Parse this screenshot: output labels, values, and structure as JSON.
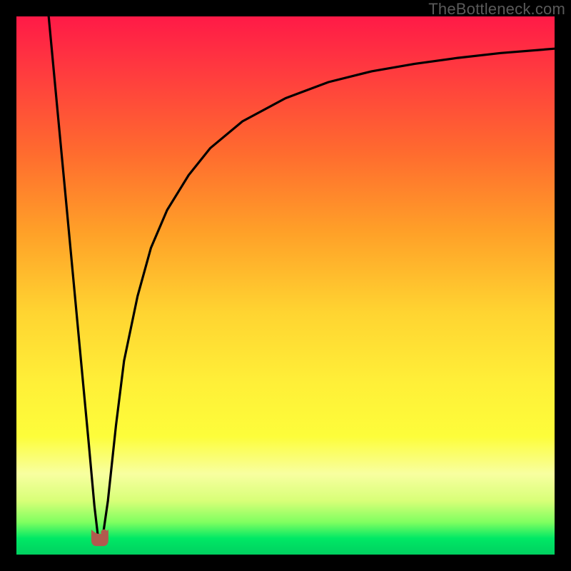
{
  "watermark": "TheBottleneck.com",
  "chart_data": {
    "type": "line",
    "title": "",
    "xlabel": "",
    "ylabel": "",
    "xlim": [
      0,
      100
    ],
    "ylim": [
      0,
      100
    ],
    "grid": false,
    "notes": "No numeric axes, tick labels, or legend are rendered in the image. Curve shape approximated from pixels; y values are relative to plot height (0 = bottom/green, 100 = top/red). The minimum sits near x ≈ 15.5 at y ≈ 2.5.",
    "series": [
      {
        "name": "left-branch",
        "x": [
          6.0,
          7.5,
          9.0,
          10.5,
          12.0,
          13.5,
          14.5,
          15.2
        ],
        "values": [
          100.0,
          84.0,
          68.0,
          52.0,
          36.0,
          20.0,
          9.0,
          3.0
        ]
      },
      {
        "name": "right-branch",
        "x": [
          16.0,
          17.0,
          18.5,
          20.0,
          22.5,
          25.0,
          28.0,
          32.0,
          36.0,
          42.0,
          50.0,
          58.0,
          66.0,
          74.0,
          82.0,
          90.0,
          100.0
        ],
        "values": [
          3.0,
          10.0,
          24.0,
          36.0,
          48.0,
          57.0,
          64.0,
          70.5,
          75.5,
          80.5,
          84.8,
          87.8,
          89.8,
          91.2,
          92.3,
          93.2,
          94.0
        ]
      }
    ],
    "marker": {
      "name": "min-marker",
      "x": 15.5,
      "y": 2.5,
      "color": "#b15a4e"
    },
    "background_gradient": {
      "top": "#ff1a47",
      "bottom": "#00d060"
    }
  }
}
